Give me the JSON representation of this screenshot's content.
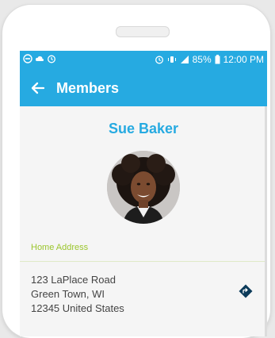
{
  "status_bar": {
    "left_icons": [
      "do-not-disturb-icon",
      "cloud-icon",
      "alarm-icon"
    ],
    "right_icons": [
      "alarm-icon",
      "vibrate-icon",
      "signal-icon"
    ],
    "battery": "85%",
    "time": "12:00 PM"
  },
  "appbar": {
    "back_icon": "arrow-left-icon",
    "title": "Members"
  },
  "member": {
    "name": "Sue Baker",
    "home_address_label": "Home Address",
    "address": {
      "line1": "123 LaPlace Road",
      "line2": "Green Town, WI",
      "line3": "12345 United States"
    },
    "navigate_icon": "directions-icon"
  },
  "colors": {
    "primary": "#26aae1",
    "accent_label": "#9bc62d",
    "text": "#444444",
    "nav_icon": "#0c3b5a"
  }
}
